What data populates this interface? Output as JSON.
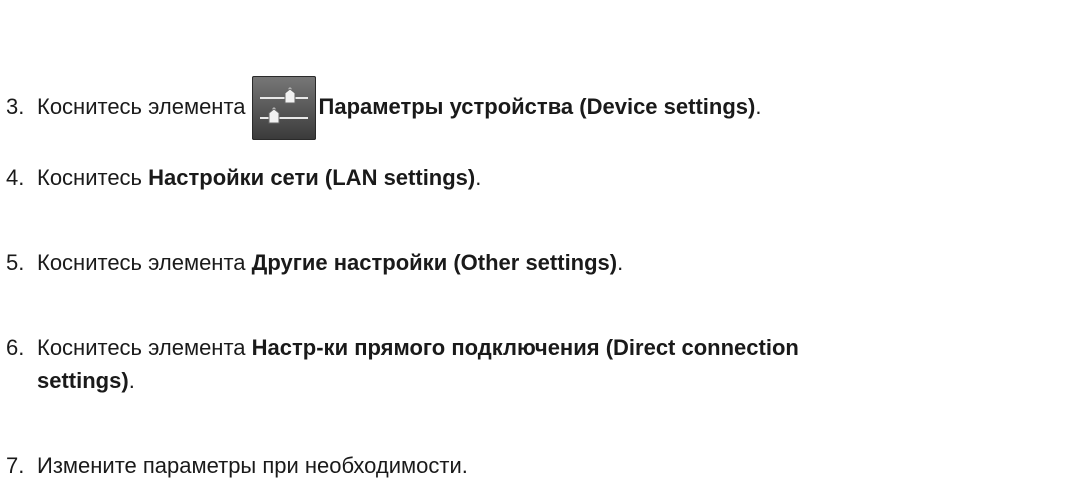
{
  "steps": [
    {
      "number": "3.",
      "prefix": "Коснитесь элемента",
      "icon": "device-settings-sliders-icon",
      "bold": "Параметры устройства (Device settings)",
      "suffix": "."
    },
    {
      "number": "4.",
      "prefix": "Коснитесь",
      "bold": "Настройки сети (LAN settings)",
      "suffix": "."
    },
    {
      "number": "5.",
      "prefix": "Коснитесь элемента",
      "bold": "Другие настройки (Other settings)",
      "suffix": "."
    },
    {
      "number": "6.",
      "prefix": "Коснитесь элемента",
      "bold": "Настр-ки прямого подключения (Direct connection",
      "bold_cont": "settings)",
      "suffix": "."
    },
    {
      "number": "7.",
      "text": "Измените параметры при необходимости."
    }
  ]
}
